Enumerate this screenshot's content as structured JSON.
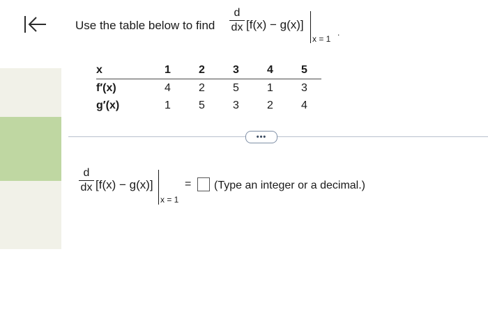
{
  "question": {
    "prefix": "Use the table below to find",
    "derivative_num": "d",
    "derivative_den": "dx",
    "expression": "[f(x) − g(x)]",
    "eval_at": "x = 1",
    "trailing": "."
  },
  "table": {
    "header": {
      "label": "x",
      "values": [
        "1",
        "2",
        "3",
        "4",
        "5"
      ]
    },
    "rows": [
      {
        "label": "f′(x)",
        "values": [
          "4",
          "2",
          "5",
          "1",
          "3"
        ]
      },
      {
        "label": "g′(x)",
        "values": [
          "1",
          "5",
          "3",
          "2",
          "4"
        ]
      }
    ]
  },
  "more_button": "•••",
  "answer": {
    "derivative_num": "d",
    "derivative_den": "dx",
    "expression": "[f(x) − g(x)]",
    "eval_at": "x = 1",
    "equals": "=",
    "value": "",
    "instruction": "(Type an integer or a decimal.)"
  },
  "colors": {
    "accent_green": "#bfd7a2",
    "divider": "#b8c0cc"
  },
  "icons": {
    "back": "arrow-left-to-bar-icon"
  }
}
